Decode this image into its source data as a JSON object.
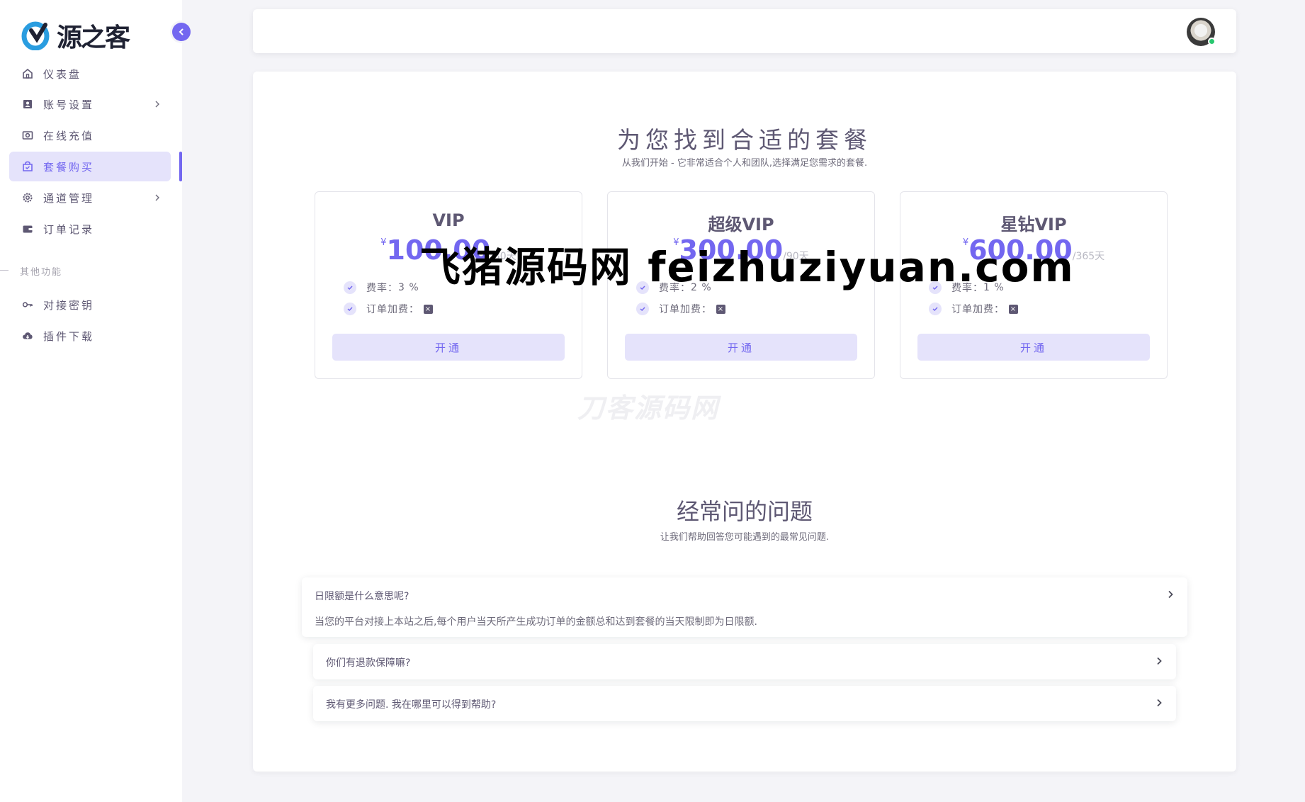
{
  "app": {
    "logo_text": "源之客"
  },
  "sidebar": {
    "items": [
      {
        "label": "仪表盘",
        "icon": "home-icon"
      },
      {
        "label": "账号设置",
        "icon": "account-icon"
      },
      {
        "label": "在线充值",
        "icon": "camera-icon"
      },
      {
        "label": "套餐购买",
        "icon": "shopping-bag-icon"
      },
      {
        "label": "通道管理",
        "icon": "gear-icon"
      },
      {
        "label": "订单记录",
        "icon": "wallet-icon"
      }
    ],
    "section_label": "其他功能",
    "other_items": [
      {
        "label": "对接密钥",
        "icon": "key-icon"
      },
      {
        "label": "插件下载",
        "icon": "cloud-download-icon"
      }
    ]
  },
  "pricing": {
    "title": "为您找到合适的套餐",
    "subtitle": "从我们开始 - 它非常适合个人和团队,选择满足您需求的套餐.",
    "plans": [
      {
        "name": "VIP",
        "currency": "¥",
        "price": "100.00",
        "period": "/30天",
        "rate_label": "费率：",
        "rate": "3 %",
        "fee_label": "订单加费：",
        "fee_value": "×",
        "button": "开通"
      },
      {
        "name": "超级VIP",
        "currency": "¥",
        "price": "300.00",
        "period": "/90天",
        "rate_label": "费率：",
        "rate": "2 %",
        "fee_label": "订单加费：",
        "fee_value": "×",
        "button": "开通"
      },
      {
        "name": "星钻VIP",
        "currency": "¥",
        "price": "600.00",
        "period": "/365天",
        "rate_label": "费率：",
        "rate": "1 %",
        "fee_label": "订单加费：",
        "fee_value": "×",
        "button": "开通"
      }
    ]
  },
  "faq": {
    "title": "经常问的问题",
    "subtitle": "让我们帮助回答您可能遇到的最常见问题.",
    "items": [
      {
        "question": "日限额是什么意思呢?",
        "answer": "当您的平台对接上本站之后,每个用户当天所产生成功订单的金额总和达到套餐的当天限制即为日限额."
      },
      {
        "question": "你们有退款保障嘛?"
      },
      {
        "question": "我有更多问题. 我在哪里可以得到帮助?"
      }
    ]
  },
  "watermarks": {
    "primary": "飞猪源码网 feizhuziyuan.com",
    "secondary": "刀客源码网"
  },
  "colors": {
    "accent": "#7367f0",
    "accent_light": "#e5e3fb",
    "online": "#28c76f"
  }
}
